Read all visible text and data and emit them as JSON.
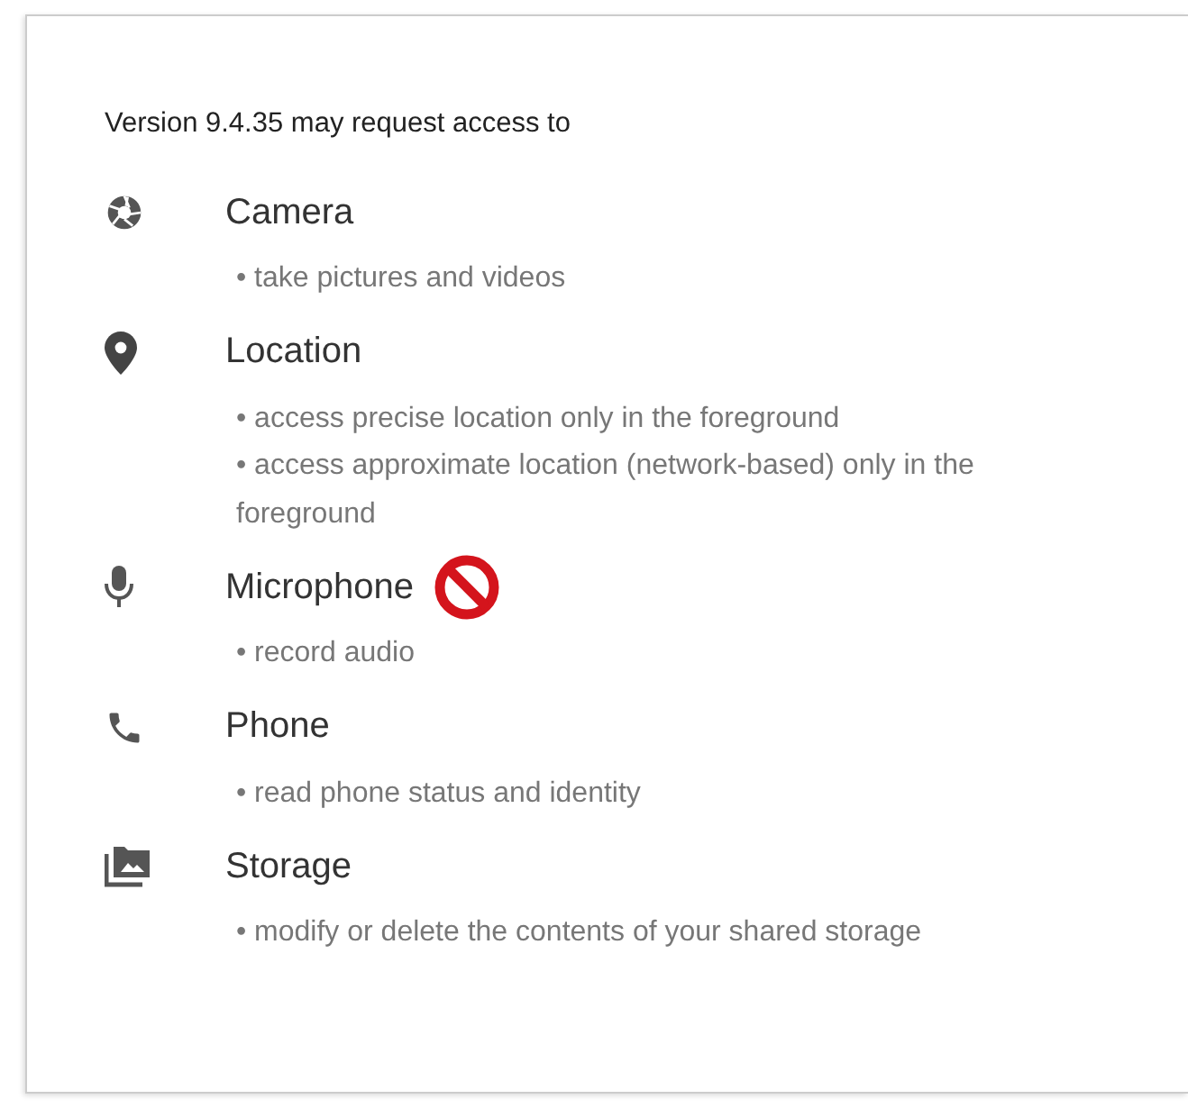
{
  "heading": "Version 9.4.35 may request access to",
  "permissions": [
    {
      "kind": "camera",
      "name": "Camera",
      "blocked": false,
      "details": [
        "• take pictures and videos"
      ]
    },
    {
      "kind": "location",
      "name": "Location",
      "blocked": false,
      "details": [
        "• access precise location only in the foreground",
        "• access approximate location (network-based) only in the foreground"
      ]
    },
    {
      "kind": "microphone",
      "name": "Microphone",
      "blocked": true,
      "details": [
        "• record audio"
      ]
    },
    {
      "kind": "phone",
      "name": "Phone",
      "blocked": false,
      "details": [
        "• read phone status and identity"
      ]
    },
    {
      "kind": "storage",
      "name": "Storage",
      "blocked": false,
      "details": [
        "• modify or delete the contents of your shared storage"
      ]
    }
  ]
}
